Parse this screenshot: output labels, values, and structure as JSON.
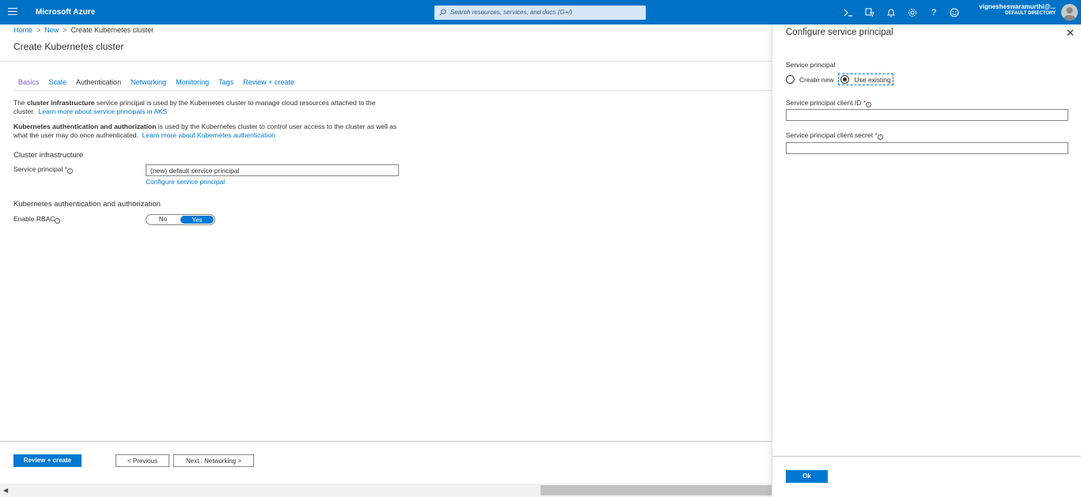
{
  "topbar": {
    "brand": "Microsoft Azure",
    "search_placeholder": "Search resources, services, and docs (G+/)",
    "user_name": "vigneshe​swaramurthi@...",
    "user_directory": "DEFAULT DIRECTORY",
    "icons": [
      "cloud-shell-icon",
      "directory-filter-icon",
      "notifications-icon",
      "settings-icon",
      "help-icon",
      "feedback-icon"
    ]
  },
  "breadcrumb": {
    "home": "Home",
    "new": "New",
    "current": "Create Kubernetes cluster"
  },
  "page_title": "Create Kubernetes cluster",
  "tabs": [
    {
      "label": "Basics"
    },
    {
      "label": "Scale"
    },
    {
      "label": "Authentication"
    },
    {
      "label": "Networking"
    },
    {
      "label": "Monitoring"
    },
    {
      "label": "Tags"
    },
    {
      "label": "Review + create"
    }
  ],
  "content": {
    "para1_prefix": "The ",
    "para1_bold": "cluster infrastructure",
    "para1_rest": " service principal is used by the Kubernetes cluster to manage cloud resources attached to the cluster.",
    "para1_link": "Learn more about service principals in AKS",
    "para2_bold": "Kubernetes authentication and authorization",
    "para2_rest": " is used by the Kubernetes cluster to control user access to the cluster as well as what the user may do once authenticated.",
    "para2_link": "Learn more about Kubernetes authentication",
    "section_infra": "Cluster infrastructure",
    "service_principal_label": "Service principal",
    "service_principal_value": "(new) default service principal",
    "configure_link": "Configure service principal",
    "section_auth": "Kubernetes authentication and authorization",
    "rbac_label": "Enable RBAC",
    "rbac_no": "No",
    "rbac_yes": "Yes",
    "rbac_value": "Yes"
  },
  "footer": {
    "review_create": "Review + create",
    "previous": "< Previous",
    "next": "Next : Networking >"
  },
  "panel": {
    "title": "Configure service principal",
    "service_principal_label": "Service principal",
    "option_create_new": "Create new",
    "option_use_existing": "Use existing",
    "selected_option": "Use existing",
    "client_id_label": "Service principal client ID",
    "client_id_value": "",
    "client_secret_label": "Service principal client secret",
    "client_secret_value": "",
    "ok": "Ok"
  },
  "colors": {
    "topbar": "#0072c6",
    "accent": "#0078d4",
    "visited_tab": "#8661c5",
    "required": "#a4262c"
  }
}
